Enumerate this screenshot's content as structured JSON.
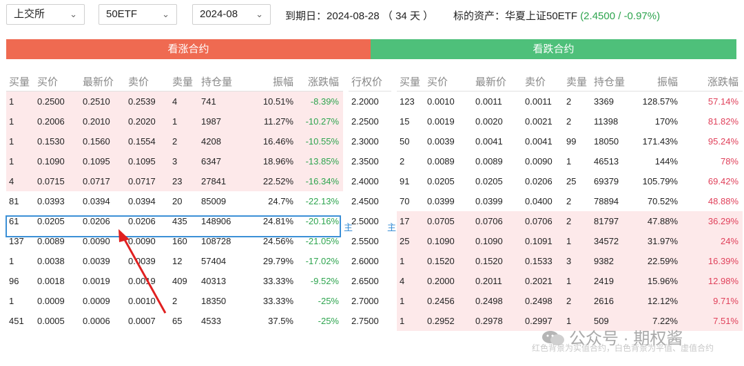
{
  "toolbar": {
    "exchange": "上交所",
    "underlying": "50ETF",
    "month": "2024-08"
  },
  "info": {
    "expiry_label": "到期日：",
    "expiry_date": "2024-08-28",
    "days": "（ 34 天 ）",
    "asset_label": "标的资产：华夏上证50ETF",
    "asset_quote": "(2.4500 / -0.97%)"
  },
  "sections": {
    "call": "看涨合约",
    "put": "看跌合约"
  },
  "headers": {
    "call": [
      "买量",
      "买价",
      "最新价",
      "卖价",
      "卖量",
      "持仓量",
      "振幅",
      "涨跌幅"
    ],
    "strike": "行权价",
    "put": [
      "买量",
      "买价",
      "最新价",
      "卖价",
      "卖量",
      "持仓量",
      "振幅",
      "涨跌幅"
    ]
  },
  "rows": [
    {
      "call": [
        "1",
        "0.2500",
        "0.2510",
        "0.2539",
        "4",
        "741",
        "10.51%",
        "-8.39%"
      ],
      "strike": "2.2000",
      "put": [
        "123",
        "0.0010",
        "0.0011",
        "0.0011",
        "2",
        "3369",
        "128.57%",
        "57.14%"
      ]
    },
    {
      "call": [
        "1",
        "0.2006",
        "0.2010",
        "0.2020",
        "1",
        "1987",
        "11.27%",
        "-10.27%"
      ],
      "strike": "2.2500",
      "put": [
        "15",
        "0.0019",
        "0.0020",
        "0.0021",
        "2",
        "11398",
        "170%",
        "81.82%"
      ]
    },
    {
      "call": [
        "1",
        "0.1530",
        "0.1560",
        "0.1554",
        "2",
        "4208",
        "16.46%",
        "-10.55%"
      ],
      "strike": "2.3000",
      "put": [
        "50",
        "0.0039",
        "0.0041",
        "0.0041",
        "99",
        "18050",
        "171.43%",
        "95.24%"
      ]
    },
    {
      "call": [
        "1",
        "0.1090",
        "0.1095",
        "0.1095",
        "3",
        "6347",
        "18.96%",
        "-13.85%"
      ],
      "strike": "2.3500",
      "put": [
        "2",
        "0.0089",
        "0.0089",
        "0.0090",
        "1",
        "46513",
        "144%",
        "78%"
      ]
    },
    {
      "call": [
        "4",
        "0.0715",
        "0.0717",
        "0.0717",
        "23",
        "27841",
        "22.52%",
        "-16.34%"
      ],
      "strike": "2.4000",
      "put": [
        "91",
        "0.0205",
        "0.0205",
        "0.0206",
        "25",
        "69379",
        "105.79%",
        "69.42%"
      ]
    },
    {
      "call": [
        "81",
        "0.0393",
        "0.0394",
        "0.0394",
        "20",
        "85009",
        "24.7%",
        "-22.13%"
      ],
      "strike": "2.4500",
      "put": [
        "70",
        "0.0399",
        "0.0399",
        "0.0400",
        "2",
        "78894",
        "70.52%",
        "48.88%"
      ]
    },
    {
      "call": [
        "61",
        "0.0205",
        "0.0206",
        "0.0206",
        "435",
        "148906",
        "24.81%",
        "-20.16%"
      ],
      "strike": "2.5000",
      "put": [
        "17",
        "0.0705",
        "0.0706",
        "0.0706",
        "2",
        "81797",
        "47.88%",
        "36.29%"
      ]
    },
    {
      "call": [
        "137",
        "0.0089",
        "0.0090",
        "0.0090",
        "160",
        "108728",
        "24.56%",
        "-21.05%"
      ],
      "strike": "2.5500",
      "put": [
        "25",
        "0.1090",
        "0.1090",
        "0.1091",
        "1",
        "34572",
        "31.97%",
        "24%"
      ]
    },
    {
      "call": [
        "1",
        "0.0038",
        "0.0039",
        "0.0039",
        "12",
        "57404",
        "29.79%",
        "-17.02%"
      ],
      "strike": "2.6000",
      "put": [
        "1",
        "0.1520",
        "0.1520",
        "0.1533",
        "3",
        "9382",
        "22.59%",
        "16.39%"
      ]
    },
    {
      "call": [
        "96",
        "0.0018",
        "0.0019",
        "0.0019",
        "409",
        "40313",
        "33.33%",
        "-9.52%"
      ],
      "strike": "2.6500",
      "put": [
        "4",
        "0.2000",
        "0.2011",
        "0.2021",
        "1",
        "2419",
        "15.96%",
        "12.98%"
      ]
    },
    {
      "call": [
        "1",
        "0.0009",
        "0.0009",
        "0.0010",
        "2",
        "18350",
        "33.33%",
        "-25%"
      ],
      "strike": "2.7000",
      "put": [
        "1",
        "0.2456",
        "0.2498",
        "0.2498",
        "2",
        "2616",
        "12.12%",
        "9.71%"
      ]
    },
    {
      "call": [
        "451",
        "0.0005",
        "0.0006",
        "0.0007",
        "65",
        "4533",
        "37.5%",
        "-25%"
      ],
      "strike": "2.7500",
      "put": [
        "1",
        "0.2952",
        "0.2978",
        "0.2997",
        "1",
        "509",
        "7.22%",
        "7.51%"
      ]
    }
  ],
  "itm_call_rows": 5,
  "itm_put_from_row": 6,
  "main_tag": "主",
  "watermark": {
    "text": "公众号 · 期权酱",
    "note": "红色背景为实值合约，白色背景为平值、虚值合约"
  },
  "colors": {
    "call_bar": "#ef6a51",
    "put_bar": "#4ec07a",
    "negative": "#2da44e",
    "positive": "#e0405a",
    "itm_bg": "#fde9ea",
    "highlight": "#3a8fd6"
  }
}
